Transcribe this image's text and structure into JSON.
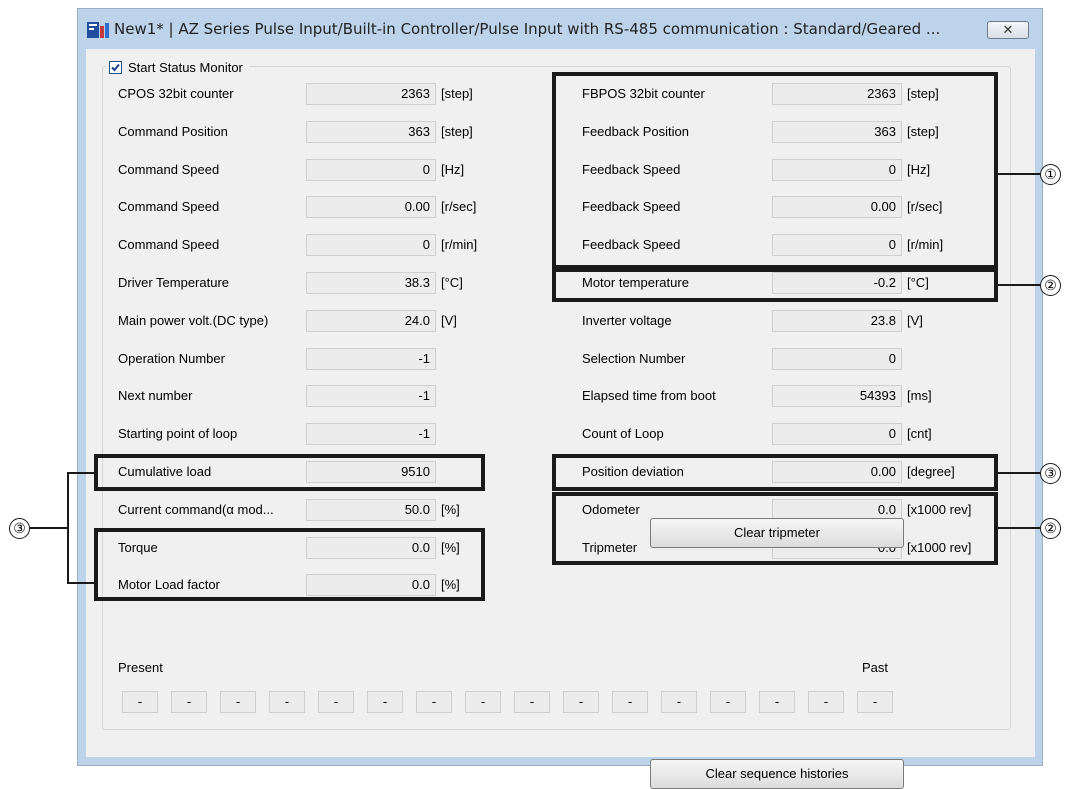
{
  "window": {
    "title": "New1* | AZ Series Pulse Input/Built-in Controller/Pulse Input with RS-485 communication : Standard/Geared ...",
    "close_glyph": "✕"
  },
  "monitor": {
    "label": "Start Status Monitor",
    "checked": true
  },
  "left_rows": [
    {
      "label": "CPOS 32bit counter",
      "value": "2363",
      "unit": "[step]"
    },
    {
      "label": "Command Position",
      "value": "363",
      "unit": "[step]"
    },
    {
      "label": "Command Speed",
      "value": "0",
      "unit": "[Hz]"
    },
    {
      "label": "Command Speed",
      "value": "0.00",
      "unit": "[r/sec]"
    },
    {
      "label": "Command Speed",
      "value": "0",
      "unit": "[r/min]"
    },
    {
      "label": "Driver Temperature",
      "value": "38.3",
      "unit": "[°C]"
    },
    {
      "label": "Main power volt.(DC type)",
      "value": "24.0",
      "unit": "[V]"
    },
    {
      "label": "Operation Number",
      "value": "-1",
      "unit": ""
    },
    {
      "label": "Next number",
      "value": "-1",
      "unit": ""
    },
    {
      "label": "Starting point of loop",
      "value": "-1",
      "unit": ""
    },
    {
      "label": "Cumulative load",
      "value": "9510",
      "unit": ""
    },
    {
      "label": "Current  command(α mod...",
      "value": "50.0",
      "unit": "[%]"
    },
    {
      "label": "Torque",
      "value": "0.0",
      "unit": "[%]"
    },
    {
      "label": "Motor Load factor",
      "value": "0.0",
      "unit": "[%]"
    }
  ],
  "right_rows": [
    {
      "label": "FBPOS 32bit counter",
      "value": "2363",
      "unit": "[step]"
    },
    {
      "label": "Feedback Position",
      "value": "363",
      "unit": "[step]"
    },
    {
      "label": "Feedback Speed",
      "value": "0",
      "unit": "[Hz]"
    },
    {
      "label": "Feedback Speed",
      "value": "0.00",
      "unit": "[r/sec]"
    },
    {
      "label": "Feedback Speed",
      "value": "0",
      "unit": "[r/min]"
    },
    {
      "label": "Motor temperature",
      "value": "-0.2",
      "unit": "[°C]"
    },
    {
      "label": "Inverter voltage",
      "value": "23.8",
      "unit": "[V]"
    },
    {
      "label": "Selection Number",
      "value": "0",
      "unit": ""
    },
    {
      "label": "Elapsed time from boot",
      "value": "54393",
      "unit": "[ms]"
    },
    {
      "label": "Count of Loop",
      "value": "0",
      "unit": "[cnt]"
    },
    {
      "label": "Position deviation",
      "value": "0.00",
      "unit": "[degree]"
    },
    {
      "label": "Odometer",
      "value": "0.0",
      "unit": "[x1000 rev]"
    },
    {
      "label": "Tripmeter",
      "value": "0.0",
      "unit": "[x1000 rev]"
    }
  ],
  "buttons": {
    "clear_tripmeter": "Clear tripmeter",
    "clear_histories": "Clear sequence histories"
  },
  "history": {
    "present_label": "Present",
    "past_label": "Past",
    "slots": [
      "-",
      "-",
      "-",
      "-",
      "-",
      "-",
      "-",
      "-",
      "-",
      "-",
      "-",
      "-",
      "-",
      "-",
      "-",
      "-"
    ]
  },
  "callouts": {
    "c1": "①",
    "c2a": "②",
    "c3a": "③",
    "c2b": "②",
    "c3b": "③"
  }
}
